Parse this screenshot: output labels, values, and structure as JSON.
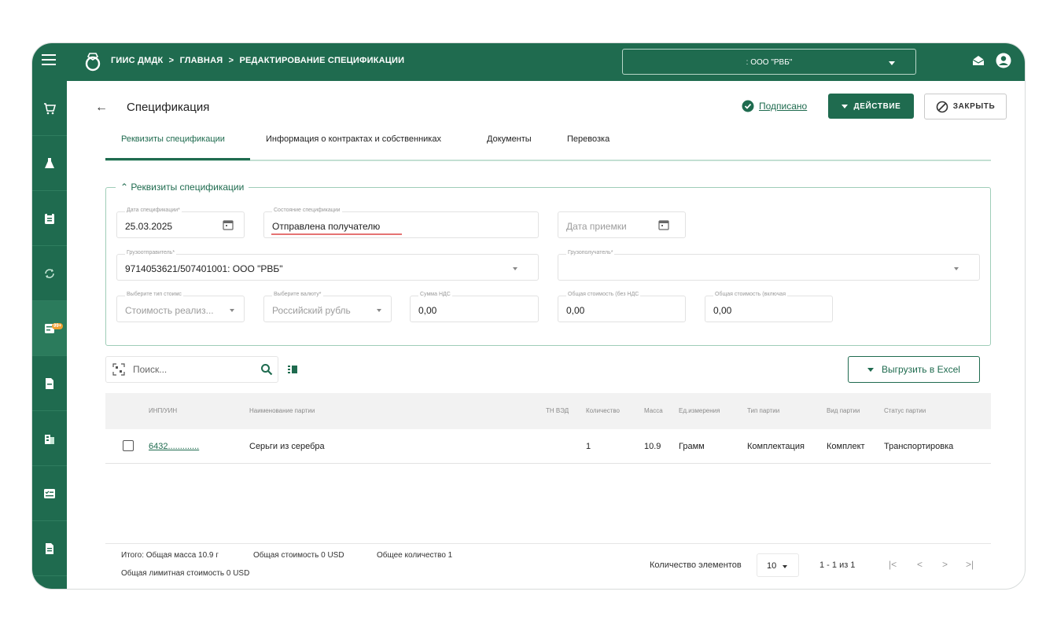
{
  "topbar": {
    "breadcrumb": [
      "ГИИС ДМДК",
      ">",
      "ГЛАВНАЯ",
      ">",
      "РЕДАКТИРОВАНИЕ СПЕЦИФИКАЦИИ"
    ],
    "org_select": ": ООО \"РВБ\"",
    "icons": [
      "menu-icon",
      "ring-logo-icon",
      "mail-open-icon",
      "user-account-icon"
    ]
  },
  "sidebar": {
    "items": [
      {
        "icon": "cart-icon"
      },
      {
        "icon": "flask-icon"
      },
      {
        "icon": "clipboard-icon"
      },
      {
        "icon": "sync-icon"
      },
      {
        "icon": "document-badge-icon",
        "badge": "99+"
      },
      {
        "icon": "file-icon"
      },
      {
        "icon": "building-icon"
      },
      {
        "icon": "checklist-icon"
      },
      {
        "icon": "report-icon"
      }
    ]
  },
  "header": {
    "title": "Спецификация",
    "signed": "Подписано",
    "action_label": "ДЕЙСТВИЕ",
    "close_label": "ЗАКРЫТЬ"
  },
  "tabs": [
    {
      "label": "Реквизиты спецификации",
      "active": true
    },
    {
      "label": "Информация о контрактах и собственниках"
    },
    {
      "label": "Документы"
    },
    {
      "label": "Перевозка"
    }
  ],
  "form": {
    "section_title": "Реквизиты спецификации",
    "spec_date": {
      "label": "Дата спецификации*",
      "value": "25.03.2025"
    },
    "spec_state": {
      "label": "Состояние спецификации",
      "value": "Отправлена получателю"
    },
    "accept_date": {
      "placeholder": "Дата приемки"
    },
    "shipper": {
      "label": "Грузоотправитель*",
      "value": "9714053621/507401001: ООО \"РВБ\""
    },
    "consignee": {
      "label": "Грузополучатель*",
      "value": ""
    },
    "cost_type": {
      "label": "Выберите тип стоимс",
      "value": "Стоимость реализ..."
    },
    "currency": {
      "label": "Выберите валюту*",
      "value": "Российский рубль"
    },
    "vat_sum": {
      "label": "Сумма НДС",
      "value": "0,00"
    },
    "total_no_vat": {
      "label": "Общая стоимость (без НДС",
      "value": "0,00"
    },
    "total_with_vat": {
      "label": "Общая стоимость (включая",
      "value": "0,00"
    }
  },
  "toolbar": {
    "search_placeholder": "Поиск...",
    "excel_label": "Выгрузить в Excel"
  },
  "table": {
    "columns": [
      "ИНП/УИН",
      "Наименование партии",
      "ТН ВЭД",
      "Количество",
      "Масса",
      "Ед.измерения",
      "Тип партии",
      "Вид партии",
      "Статус партии"
    ],
    "rows": [
      {
        "inp": "6432.............",
        "name": "Серьги из серебра",
        "tnved": "",
        "qty": "1",
        "mass": "10.9",
        "unit": "Грамм",
        "type": "Комплектация",
        "kind": "Комплект",
        "status": "Транспортировка"
      }
    ]
  },
  "footer": {
    "total_mass": "Итого: Общая масса 10.9 г",
    "total_cost": "Общая стоимость 0 USD",
    "total_qty": "Общее количество 1",
    "limit_cost": "Общая лимитная стоимость 0 USD",
    "page_size_label": "Количество элементов",
    "page_size": "10",
    "range": "1 - 1 из 1",
    "nav": [
      "|<",
      "<",
      ">",
      ">|"
    ]
  }
}
